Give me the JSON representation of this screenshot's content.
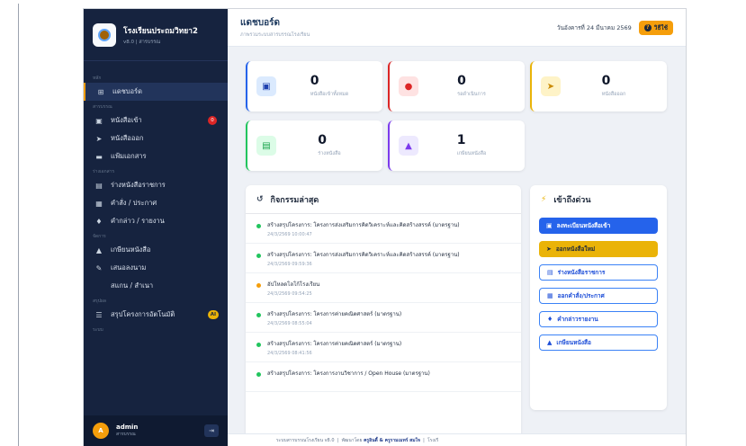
{
  "brand": {
    "title": "โรงเรียนประถมวิทยา2",
    "subtitle": "v8.0 | สารบรรณ"
  },
  "sidebar": {
    "sec_main": "หลัก",
    "dashboard": "แดชบอร์ด",
    "sec_saraban": "สารบรรณ",
    "inbox": "หนังสือเข้า",
    "inbox_badge": "0",
    "outbox": "หนังสือออก",
    "folder": "แฟ้มเอกสาร",
    "sec_docs": "ร่างเอกสาร",
    "draft_official": "ร่างหนังสือราชการ",
    "order": "คำสั่ง / ประกาศ",
    "speech": "คำกล่าว / รายงาน",
    "sec_manage": "จัดการ",
    "sign": "เกษียนหนังสือ",
    "propose": "เสนอลงนาม",
    "scan": "สแกน / สำเนา",
    "sec_summary": "สรุปผล",
    "project_ai": "สรุปโครงการอัตโนมัติ",
    "ai_badge": "AI",
    "sec_system": "ระบบ"
  },
  "user": {
    "name": "admin",
    "role": "สารบรรณ",
    "avatar": "A"
  },
  "header": {
    "title": "แดชบอร์ด",
    "subtitle": "ภาพรวมระบบสารบรรณโรงเรียน",
    "date": "วันอังคารที่ 24 มีนาคม 2569",
    "help": "วิธีใช้"
  },
  "stats": [
    {
      "value": "0",
      "label": "หนังสือเข้าทั้งหมด"
    },
    {
      "value": "0",
      "label": "รอดำเนินการ"
    },
    {
      "value": "0",
      "label": "หนังสือออก"
    },
    {
      "value": "0",
      "label": "ร่างหนังสือ"
    },
    {
      "value": "1",
      "label": "เกษียนหนังสือ"
    }
  ],
  "activity": {
    "title": "กิจกรรมล่าสุด",
    "items": [
      {
        "text": "สร้างสรุปโครงการ: โครงการส่งเสริมการคิดวิเคราะห์และคิดสร้างสรรค์ (มาตรฐาน)",
        "time": "24/3/2569 10:00:47",
        "color": "#22c55e"
      },
      {
        "text": "สร้างสรุปโครงการ: โครงการส่งเสริมการคิดวิเคราะห์และคิดสร้างสรรค์ (มาตรฐาน)",
        "time": "24/3/2569 09:59:36",
        "color": "#22c55e"
      },
      {
        "text": "อัปโหลดโลโก้โรงเรียน",
        "time": "24/3/2569 09:54:25",
        "color": "#f59e0b"
      },
      {
        "text": "สร้างสรุปโครงการ: โครงการค่ายคณิตศาสตร์ (มาตรฐาน)",
        "time": "24/3/2569 08:55:04",
        "color": "#22c55e"
      },
      {
        "text": "สร้างสรุปโครงการ: โครงการค่ายคณิตศาสตร์ (มาตรฐาน)",
        "time": "24/3/2569 08:41:56",
        "color": "#22c55e"
      },
      {
        "text": "สร้างสรุปโครงการ: โครงการงานวิชาการ / Open House (มาตรฐาน)",
        "time": "",
        "color": "#22c55e"
      }
    ]
  },
  "quick": {
    "title": "เข้าถึงด่วน",
    "buttons": [
      "ลงทะเบียนหนังสือเข้า",
      "ออกหนังสือใหม่",
      "ร่างหนังสือราชการ",
      "ออกคำสั่ง/ประกาศ",
      "คำกล่าวรายงาน",
      "เกษียนหนังสือ"
    ]
  },
  "footer": {
    "system": "ระบบสารบรรณโรงเรียน v8.0",
    "sep": "|",
    "dev_prefix": "พัฒนาโดย",
    "dev": "ครูอินดี้ & ครูรามเมทร์ สมใจ",
    "school": "โรงเรี"
  },
  "colors": {
    "sidebar": "#16233f",
    "accent": "#f59e0b",
    "blue": "#2563eb",
    "yellow": "#eab308",
    "red": "#dc2626",
    "green": "#22c55e",
    "purple": "#7c3aed"
  }
}
